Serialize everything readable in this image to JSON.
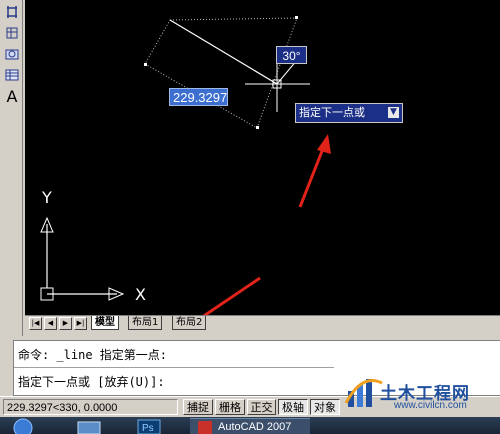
{
  "canvas": {
    "dimension_value": "229.3297",
    "angle_tooltip": "30°",
    "prompt_tooltip": "指定下一点或",
    "ucs_y_label": "Y",
    "ucs_x_label": "X"
  },
  "toolbar": {
    "text_tool": "A"
  },
  "layout_tabs": {
    "tabs": [
      "模型",
      "布局1",
      "布局2"
    ],
    "active": "模型"
  },
  "command": {
    "line1": "命令: _line 指定第一点:",
    "line2": "指定下一点或 [放弃(U)]:"
  },
  "status": {
    "coordinates": "229.3297<330, 0.0000",
    "buttons": [
      "捕捉",
      "栅格",
      "正交",
      "极轴",
      "对象"
    ]
  },
  "taskbar": {
    "app_label": "AutoCAD 2007"
  },
  "watermark": {
    "title": "土木工程网",
    "url": "www.civilcn.com"
  },
  "colors": {
    "canvas_bg": "#000000",
    "tooltip_bg": "#1c2f86",
    "annotation_arrow": "#e2231a",
    "dimension_highlight": "#3d6fd1"
  }
}
